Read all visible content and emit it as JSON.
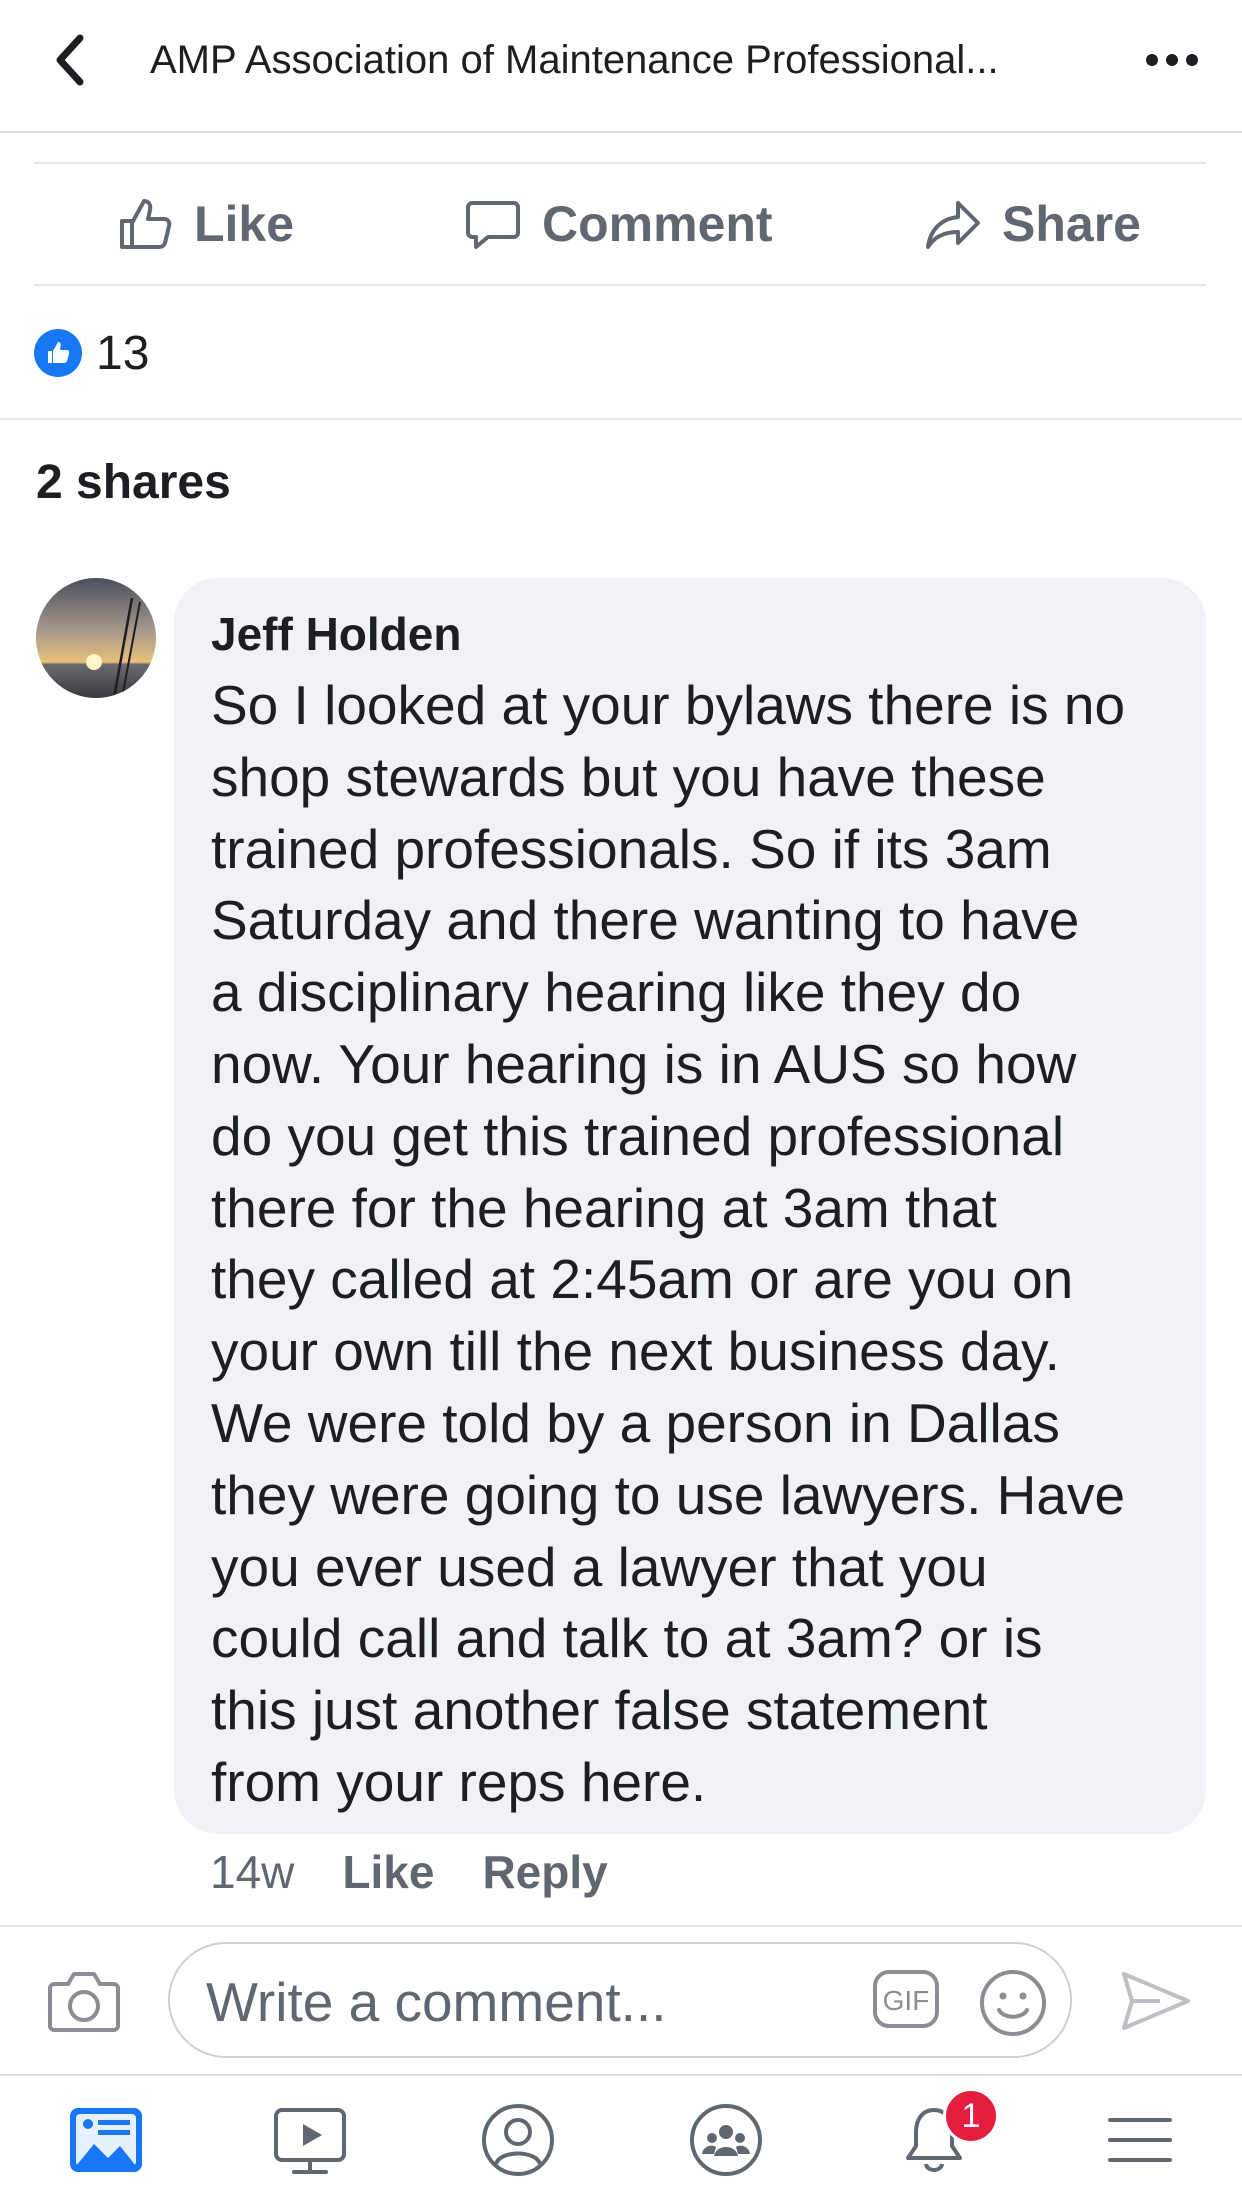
{
  "header": {
    "title": "AMP Association of Maintenance Professional...",
    "back_icon": "chevron-left-icon",
    "more_icon": "more-horizontal-icon"
  },
  "actions": {
    "like": "Like",
    "comment": "Comment",
    "share": "Share"
  },
  "reactions": {
    "count": "13"
  },
  "shares": "2 shares",
  "comment": {
    "author": "Jeff Holden",
    "lines": [
      "So I looked at your bylaws there is no",
      "shop stewards but you have these",
      "trained professionals. So if its 3am",
      "Saturday and there wanting to have",
      "a disciplinary hearing like they do",
      "now. Your hearing is in AUS so how",
      "do you get this trained professional",
      "there for the hearing at 3am that",
      "they called at 2:45am or are you on",
      "your own till the next business day.",
      "We were told by a person in Dallas",
      "they were going to use lawyers. Have",
      "you ever used a lawyer that you",
      "could call and talk to at 3am? or is",
      "this just another false statement",
      "from your reps here."
    ],
    "time": "14w",
    "like": "Like",
    "reply": "Reply"
  },
  "composer": {
    "placeholder": "Write a comment...",
    "gif_label": "GIF"
  },
  "nav": {
    "notifications_badge": "1"
  },
  "colors": {
    "accent": "#1877f2",
    "badge": "#e41e3f",
    "muted": "#606770",
    "bubble": "#f0f2f5"
  }
}
